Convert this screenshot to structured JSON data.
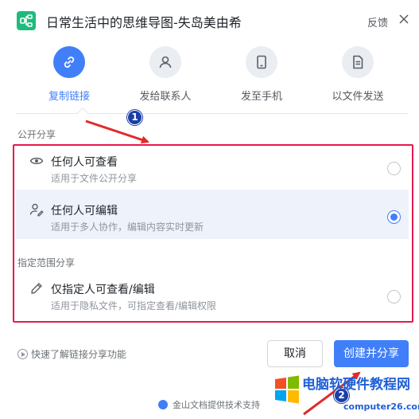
{
  "window": {
    "title": "日常生活中的思维导图-失岛美由希",
    "feedback_label": "反馈"
  },
  "share_tabs": [
    {
      "label": "复制链接",
      "icon": "link-icon",
      "active": true
    },
    {
      "label": "发给联系人",
      "icon": "person-icon",
      "active": false
    },
    {
      "label": "发至手机",
      "icon": "phone-icon",
      "active": false
    },
    {
      "label": "以文件发送",
      "icon": "file-icon",
      "active": false
    }
  ],
  "public_section": {
    "label": "公开分享",
    "options": [
      {
        "title": "任何人可查看",
        "desc": "适用于文件公开分享",
        "icon": "eye-icon",
        "selected": false
      },
      {
        "title": "任何人可编辑",
        "desc": "适用于多人协作，编辑内容实时更新",
        "icon": "edit-person-icon",
        "selected": true
      }
    ]
  },
  "restricted_section": {
    "label": "指定范围分享",
    "options": [
      {
        "title": "仅指定人可查看/编辑",
        "desc": "适用于隐私文件，可指定查看/编辑权限",
        "icon": "pencil-icon",
        "selected": false
      }
    ]
  },
  "footer": {
    "help_link": "快速了解链接分享功能",
    "cancel_label": "取消",
    "create_label": "创建并分享",
    "powered_by": "金山文档提供技术支持"
  },
  "annotations": {
    "badge_1": "1",
    "badge_2": "2"
  },
  "watermark": {
    "text": "电脑软硬件教程网",
    "url": "computer26.com"
  },
  "colors": {
    "accent": "#417ff9",
    "highlight": "#e7194e",
    "app_icon": "#1fbb7d",
    "selected_row": "#eef2fb"
  }
}
